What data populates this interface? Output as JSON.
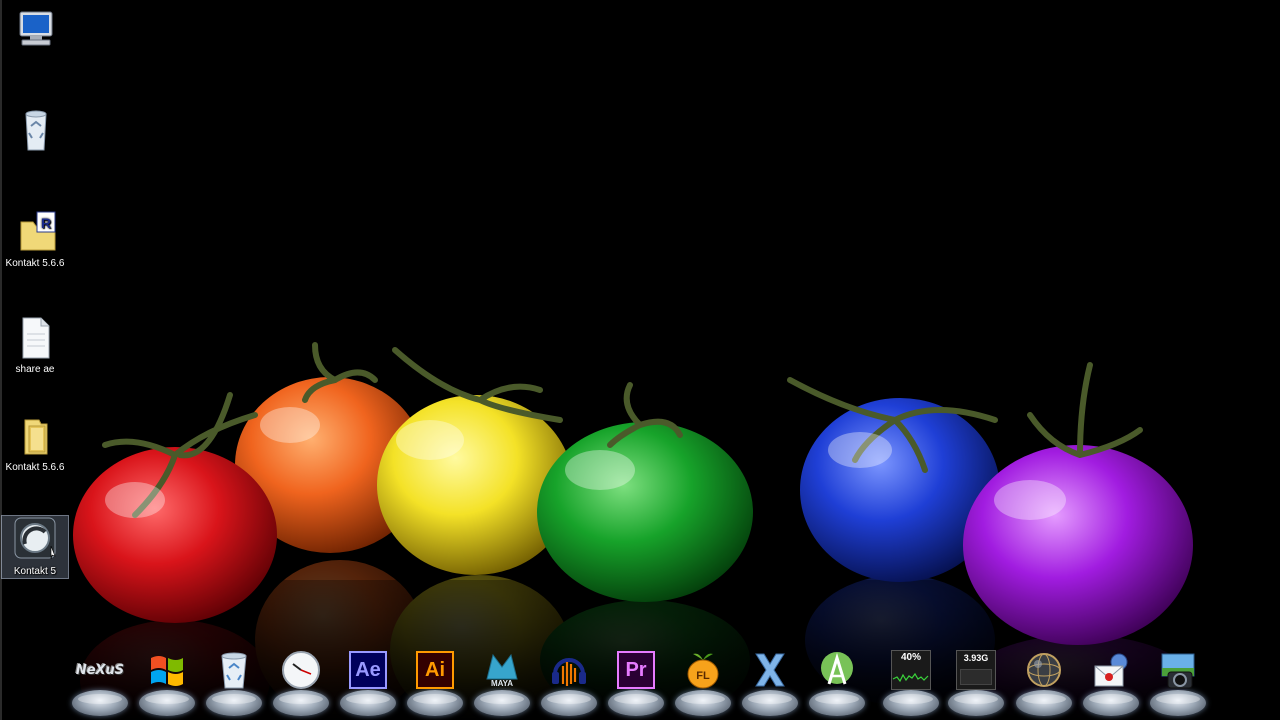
{
  "desktop": {
    "icons": [
      {
        "id": "computer",
        "label": "",
        "icon": "computer-icon"
      },
      {
        "id": "recycle-bin",
        "label": "",
        "icon": "recycle-bin-icon"
      },
      {
        "id": "kontakt-folder-r",
        "label": "Kontakt 5.6.6",
        "icon": "folder-r-icon"
      },
      {
        "id": "share-ae",
        "label": "share ae",
        "icon": "document-icon"
      },
      {
        "id": "kontakt-folder",
        "label": "Kontakt 5.6.6",
        "icon": "folder-icon"
      },
      {
        "id": "kontakt-5",
        "label": "Kontakt 5",
        "icon": "kontakt-icon",
        "selected": true
      }
    ]
  },
  "dock": {
    "items": [
      {
        "id": "nexus",
        "label": "NeXuS",
        "icon": "nexus-logo-icon"
      },
      {
        "id": "windows",
        "label": "",
        "icon": "windows-logo-icon"
      },
      {
        "id": "recycle-bin",
        "label": "",
        "icon": "recycle-bin-icon"
      },
      {
        "id": "clock",
        "label": "",
        "icon": "clock-icon"
      },
      {
        "id": "after-effects",
        "label": "Ae",
        "icon": "after-effects-icon",
        "color": "#9999ff",
        "bg": "#00005b"
      },
      {
        "id": "illustrator",
        "label": "Ai",
        "icon": "illustrator-icon",
        "color": "#ff9a00",
        "bg": "#330000"
      },
      {
        "id": "maya",
        "label": "MAYA",
        "icon": "maya-icon",
        "color": "#37a5cc"
      },
      {
        "id": "audacity",
        "label": "",
        "icon": "audacity-icon"
      },
      {
        "id": "premiere",
        "label": "Pr",
        "icon": "premiere-icon",
        "color": "#e77bff",
        "bg": "#2a0033"
      },
      {
        "id": "fl-studio",
        "label": "",
        "icon": "fl-studio-icon"
      },
      {
        "id": "x-app",
        "label": "",
        "icon": "x-icon"
      },
      {
        "id": "android-studio",
        "label": "",
        "icon": "android-studio-icon"
      },
      {
        "id": "cpu-meter",
        "label": "40%",
        "icon": "cpu-meter-icon"
      },
      {
        "id": "memory-meter",
        "label": "3.93G",
        "icon": "memory-meter-icon"
      },
      {
        "id": "network",
        "label": "",
        "icon": "globe-icon"
      },
      {
        "id": "mail",
        "label": "",
        "icon": "mail-icon"
      },
      {
        "id": "screenshot",
        "label": "",
        "icon": "camera-icon"
      }
    ]
  },
  "colors": {
    "background": "#000000",
    "tomato_red": "#d9141a",
    "tomato_orange": "#f0641e",
    "tomato_yellow": "#f4e227",
    "tomato_green": "#17a32a",
    "tomato_blue": "#1f3fd6",
    "tomato_purple": "#a11ce0"
  }
}
